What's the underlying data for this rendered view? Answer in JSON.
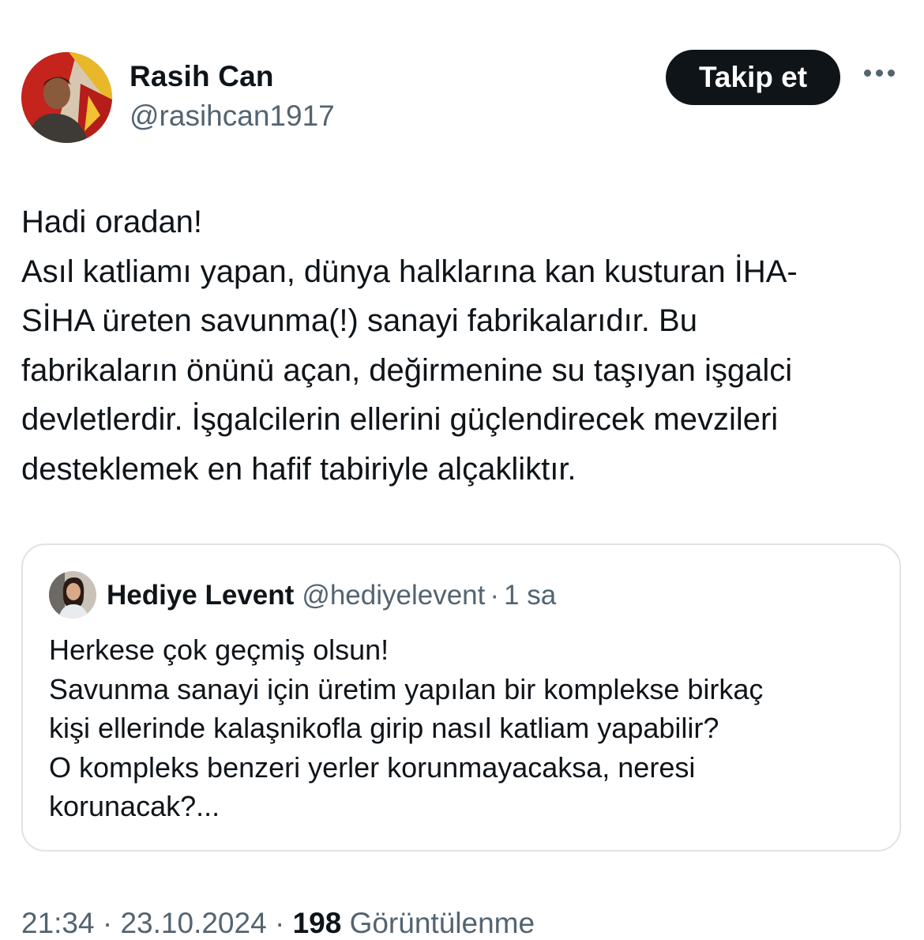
{
  "tweet": {
    "author": {
      "name": "Rasih Can",
      "handle": "@rasihcan1917"
    },
    "follow_label": "Takip et",
    "more_icon": "more-horizontal-icon",
    "lines": [
      "Hadi oradan!",
      "Asıl katliamı yapan, dünya halklarına kan kusturan İHA-",
      "SİHA üreten savunma(!) sanayi fabrikalarıdır. Bu",
      "fabrikaların önünü açan, değirmenine su taşıyan işgalci",
      "devletlerdir. İşgalcilerin ellerini güçlendirecek mevzileri",
      "desteklemek en hafif tabiriyle alçakliktır."
    ]
  },
  "quote": {
    "author": {
      "name": "Hediye Levent",
      "handle": "@hediyelevent",
      "separator": "·",
      "time": "1 sa"
    },
    "lines": [
      "Herkese çok geçmiş olsun!",
      "Savunma sanayi için üretim yapılan bir komplekse birkaç",
      "kişi ellerinde kalaşnikofla girip nasıl katliam yapabilir?",
      "O kompleks benzeri yerler korunmayacaksa, neresi",
      "korunacak?..."
    ]
  },
  "footer": {
    "time": "21:34",
    "separator": "·",
    "date": "23.10.2024",
    "views_count": "198",
    "views_label": "Görüntülenme"
  },
  "colors": {
    "text": "#0f1419",
    "secondary": "#536471",
    "border": "#dfe3e6",
    "button_bg": "#0f1419"
  }
}
